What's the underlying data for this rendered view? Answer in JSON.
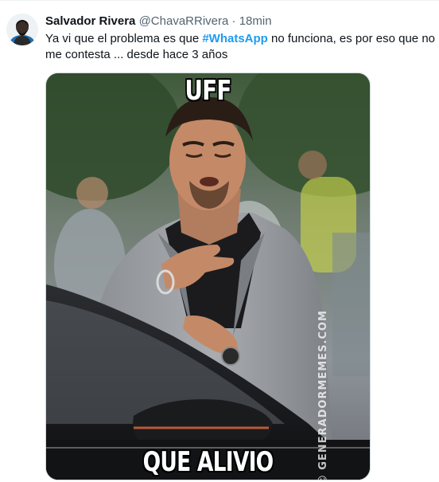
{
  "tweet": {
    "author_name": "Salvador Rivera",
    "handle": "@ChavaRRivera",
    "separator": "·",
    "time": "18min",
    "text_line1_before": "Ya vi que el problema es que ",
    "hashtag": "#WhatsApp",
    "text_line1_after": " no funciona, es por eso que no",
    "text_line2": "me contesta ... desde hace 3 años",
    "avatar_icon": "user-avatar"
  },
  "media": {
    "top_caption": "UFF",
    "bottom_caption": "QUE ALIVIO",
    "watermark": "GENERADORMEMES.COM",
    "watermark_icon": "smiley-icon"
  }
}
